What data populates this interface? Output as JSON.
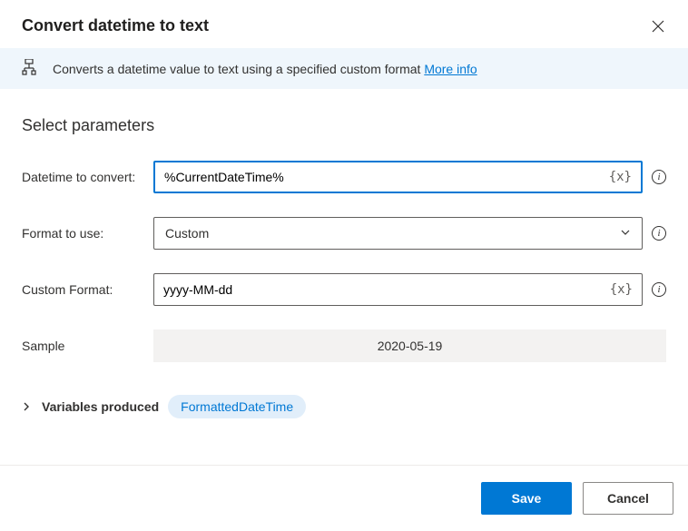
{
  "header": {
    "title": "Convert datetime to text"
  },
  "banner": {
    "description": "Converts a datetime value to text using a specified custom format ",
    "linkText": "More info"
  },
  "section": {
    "title": "Select parameters"
  },
  "fields": {
    "datetime": {
      "label": "Datetime to convert:",
      "value": "%CurrentDateTime%"
    },
    "format": {
      "label": "Format to use:",
      "value": "Custom"
    },
    "custom": {
      "label": "Custom Format:",
      "value": "yyyy-MM-dd"
    },
    "sample": {
      "label": "Sample",
      "value": "2020-05-19"
    }
  },
  "variables": {
    "label": "Variables produced",
    "produced": "FormattedDateTime"
  },
  "footer": {
    "save": "Save",
    "cancel": "Cancel"
  },
  "glyphs": {
    "varBadge": "{x}",
    "info": "i"
  }
}
